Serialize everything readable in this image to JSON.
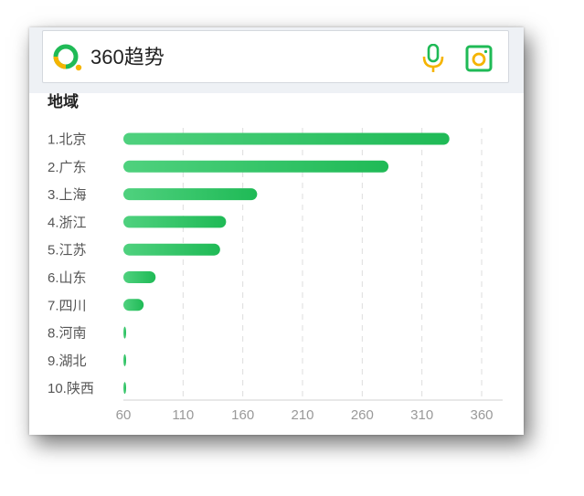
{
  "app": {
    "brand": "360趋势",
    "accent": "#1fba56",
    "icons": {
      "logo": "360-logo-icon",
      "mic": "microphone-icon",
      "camera": "camera-icon"
    }
  },
  "section": {
    "title": "地域"
  },
  "chart_data": {
    "type": "bar",
    "orientation": "horizontal",
    "categories": [
      "1.北京",
      "2.广东",
      "3.上海",
      "4.浙江",
      "5.江苏",
      "6.山东",
      "7.四川",
      "8.河南",
      "9.湖北",
      "10.陕西"
    ],
    "values": [
      333,
      282,
      172,
      146,
      141,
      87,
      77,
      62,
      61,
      61
    ],
    "xlim": [
      60,
      360
    ],
    "xticks": [
      60,
      110,
      160,
      210,
      260,
      310,
      360
    ],
    "grid": "vertical-dashed",
    "bar_color": "#1fba56"
  }
}
